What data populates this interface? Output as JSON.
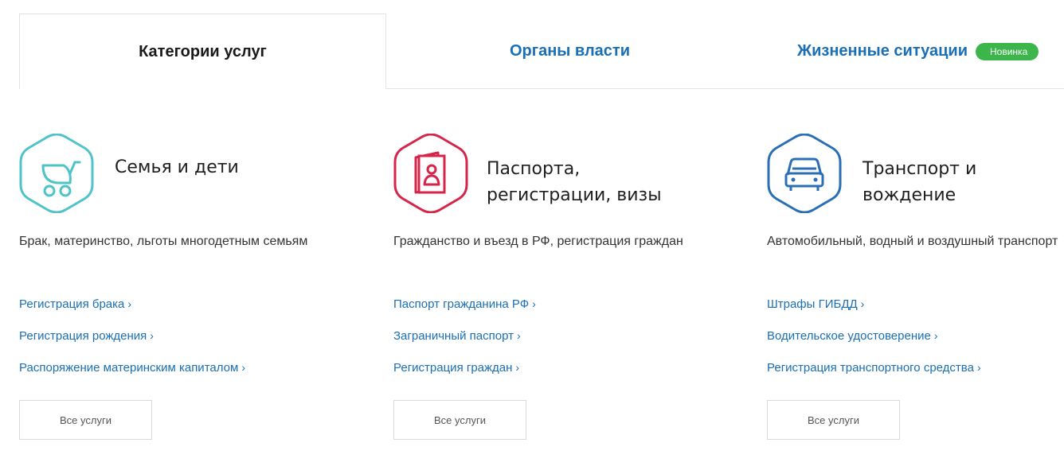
{
  "tabs": [
    {
      "label": "Категории услуг",
      "active": true
    },
    {
      "label": "Органы власти",
      "active": false
    },
    {
      "label": "Жизненные ситуации",
      "active": false,
      "badge": "Новинка"
    }
  ],
  "categories": [
    {
      "icon": "baby-stroller-icon",
      "icon_color": "#4fc3c8",
      "title_line1": "Семья и дети",
      "title_line2": "",
      "description": "Брак, материнство, льготы многодетным семьям",
      "links": [
        "Регистрация брака",
        "Регистрация рождения",
        "Распоряжение материнским капиталом"
      ],
      "all_button": "Все услуги"
    },
    {
      "icon": "passport-icon",
      "icon_color": "#d6254a",
      "title_line1": "Паспорта,",
      "title_line2": "регистрации, визы",
      "description": "Гражданство и въезд в РФ, регистрация граждан",
      "links": [
        "Паспорт гражданина РФ",
        "Заграничный паспорт",
        "Регистрация граждан"
      ],
      "all_button": "Все услуги"
    },
    {
      "icon": "car-icon",
      "icon_color": "#2a6fb5",
      "title_line1": "Транспорт и",
      "title_line2": "вождение",
      "description": "Автомобильный, водный и воздушный транспорт",
      "links": [
        "Штрафы ГИБДД",
        "Водительское удостоверение",
        "Регистрация транспортного средства"
      ],
      "all_button": "Все услуги"
    }
  ],
  "colors": {
    "link": "#1a6fb5",
    "badge": "#3cb54a"
  }
}
